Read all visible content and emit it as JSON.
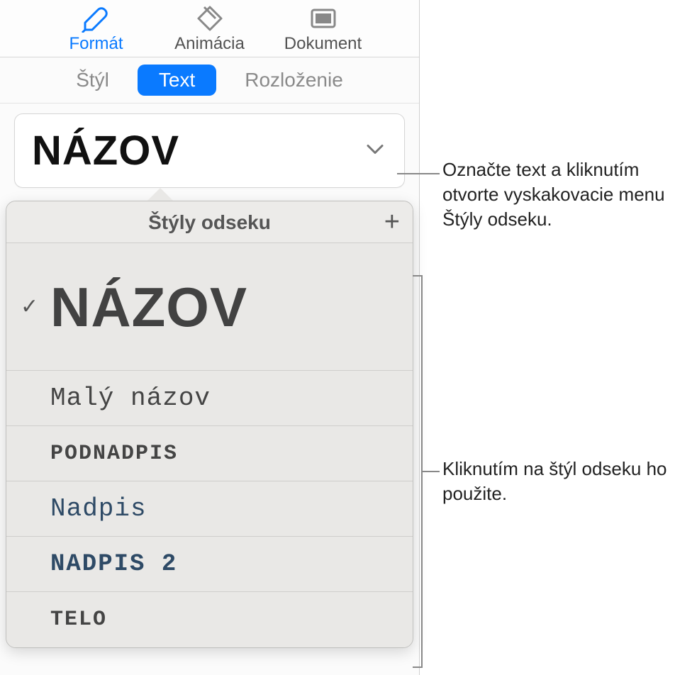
{
  "toolbar": {
    "items": [
      {
        "label": "Formát"
      },
      {
        "label": "Animácia"
      },
      {
        "label": "Dokument"
      }
    ]
  },
  "sub_tabs": {
    "items": [
      {
        "label": "Štýl"
      },
      {
        "label": "Text"
      },
      {
        "label": "Rozloženie"
      }
    ],
    "active_index": 1
  },
  "style_selector": {
    "current": "NÁZOV"
  },
  "popover": {
    "title": "Štýly odseku",
    "add_icon": "+",
    "check_icon": "✓",
    "styles": [
      {
        "name": "NÁZOV",
        "selected": true
      },
      {
        "name": "Malý názov",
        "selected": false
      },
      {
        "name": "PODNADPIS",
        "selected": false
      },
      {
        "name": "Nadpis",
        "selected": false
      },
      {
        "name": "NADPIS 2",
        "selected": false
      },
      {
        "name": "TELO",
        "selected": false
      }
    ]
  },
  "callouts": {
    "c1": "Označte text a kliknutím otvorte vyskakovacie menu Štýly odseku.",
    "c2": "Kliknutím na štýl odseku ho použite."
  }
}
